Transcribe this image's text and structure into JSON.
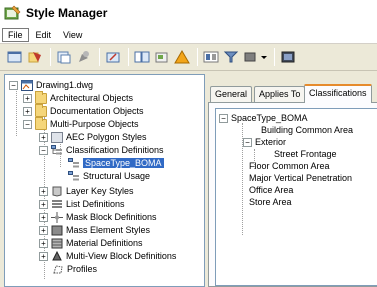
{
  "window": {
    "title": "Style Manager"
  },
  "menu": {
    "items": [
      {
        "label": "File"
      },
      {
        "label": "Edit"
      },
      {
        "label": "View"
      }
    ]
  },
  "toolbar": {
    "icons": [
      "open-drawing-icon",
      "copy-icon",
      "paste-icon",
      "edit-style-icon",
      "purge-icon",
      "toggle-view-icon",
      "filter-icon",
      "color-icon",
      "dropdown-icon",
      "inline-edit-icon"
    ]
  },
  "left_tree": {
    "root": "Drawing1.dwg",
    "top_items": [
      "Architectural Objects",
      "Documentation Objects",
      "Multi-Purpose Objects"
    ],
    "mp_items": [
      "AEC Polygon Styles",
      "Classification Definitions",
      "SpaceType_BOMA",
      "Structural Usage",
      "Layer Key Styles",
      "List Definitions",
      "Mask Block Definitions",
      "Mass Element Styles",
      "Material Definitions",
      "Multi-View Block Definitions",
      "Profiles"
    ]
  },
  "tabs": [
    {
      "label": "General"
    },
    {
      "label": "Applies To"
    },
    {
      "label": "Classifications"
    }
  ],
  "right_tree": {
    "root": "SpaceType_BOMA",
    "items": [
      "Building Common Area",
      "Exterior",
      "Street Frontage",
      "Floor Common Area",
      "Major Vertical Penetration",
      "Office Area",
      "Store Area"
    ]
  },
  "colors": {
    "selection": "#316ac5",
    "active_tab_accent": "#e68b2c",
    "window_bg": "#ece9d8"
  }
}
